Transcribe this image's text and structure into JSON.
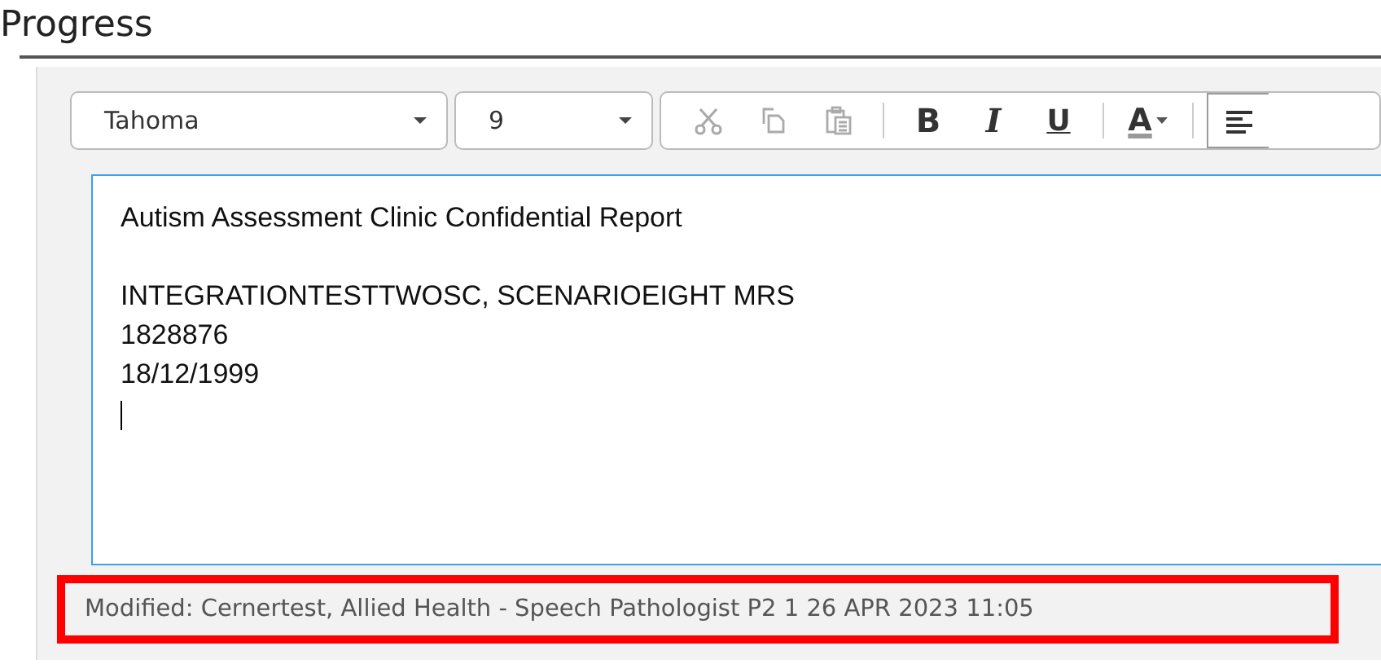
{
  "title": "Progress",
  "toolbar": {
    "font": {
      "value": "Tahoma"
    },
    "size": {
      "value": "9"
    },
    "buttons": [
      {
        "kind": "cut",
        "disabled": true,
        "selected": false
      },
      {
        "kind": "copy",
        "disabled": true,
        "selected": false
      },
      {
        "kind": "paste",
        "disabled": true,
        "selected": false
      },
      {
        "kind": "separator"
      },
      {
        "kind": "bold",
        "label": "B",
        "disabled": false,
        "selected": false
      },
      {
        "kind": "italic",
        "label": "I",
        "disabled": false,
        "selected": false
      },
      {
        "kind": "underline",
        "label": "U",
        "disabled": false,
        "selected": false
      },
      {
        "kind": "separator"
      },
      {
        "kind": "color",
        "label": "A",
        "disabled": false,
        "selected": false
      },
      {
        "kind": "separator"
      },
      {
        "kind": "align-left",
        "disabled": false,
        "selected": true
      }
    ]
  },
  "editor": {
    "heading": "Autism Assessment Clinic Confidential Report",
    "lines": [
      "INTEGRATIONTESTTWOSC, SCENARIOEIGHT MRS",
      "1828876",
      "18/12/1999"
    ],
    "caret": true
  },
  "status": {
    "text": "Modified: Cernertest, Allied Health - Speech Pathologist P2 1 26 APR 2023 11:05",
    "highlighted": true
  }
}
